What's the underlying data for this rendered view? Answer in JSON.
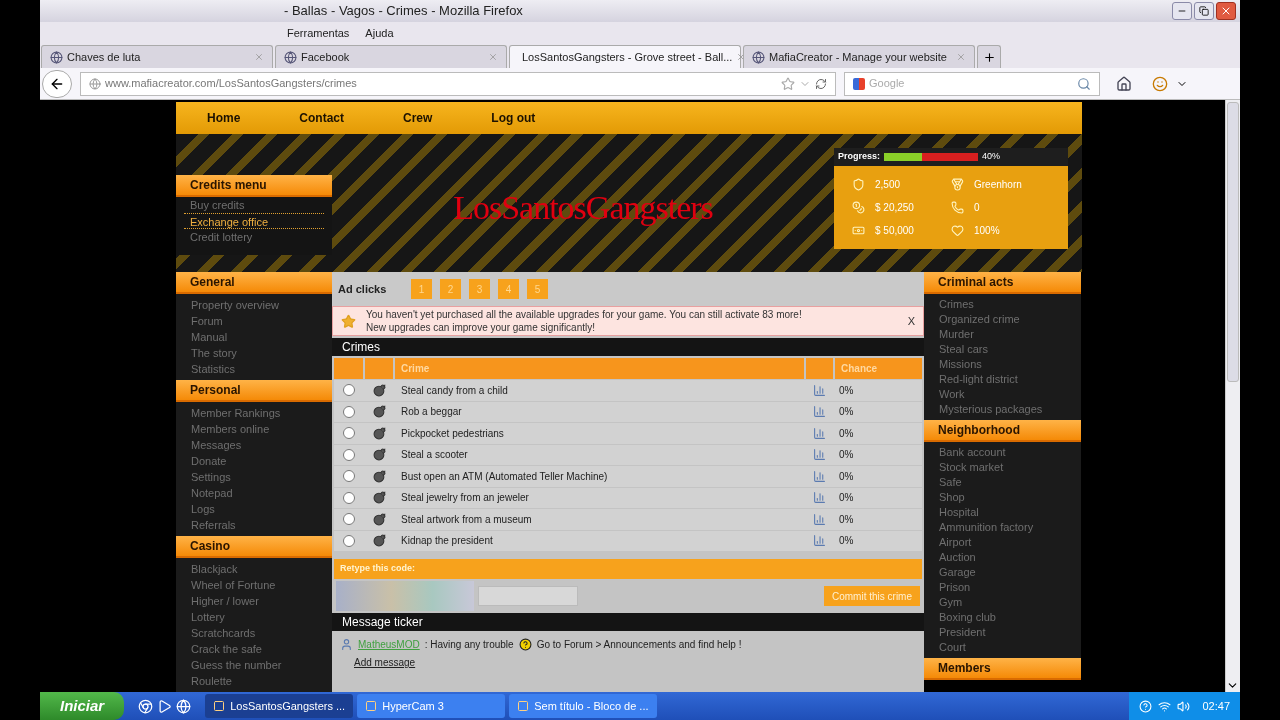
{
  "window": {
    "title": "- Ballas - Vagos - Crimes - Mozilla Firefox"
  },
  "menu": [
    "Ferramentas",
    "Ajuda"
  ],
  "tabs": [
    {
      "label": "Chaves de luta",
      "selected": false
    },
    {
      "label": "Facebook",
      "selected": false
    },
    {
      "label": "LosSantosGangsters - Grove street - Ball...",
      "selected": true
    },
    {
      "label": "MafiaCreator - Manage your website",
      "selected": false
    }
  ],
  "address": {
    "url": "www.mafiacreator.com/LosSantosGangsters/crimes"
  },
  "search": {
    "placeholder": "Google"
  },
  "site_nav": [
    "Home",
    "Contact",
    "Crew",
    "Log out"
  ],
  "banner": {
    "logo": "LosSantosGangsters"
  },
  "progress": {
    "label": "Progress:",
    "level": 0.4,
    "reading": "40%"
  },
  "stats": [
    {
      "kind": "shield",
      "value": "2,500"
    },
    {
      "kind": "medal",
      "value": "Greenhorn"
    },
    {
      "kind": "coins",
      "value": "$ 20,250"
    },
    {
      "kind": "phone",
      "value": "0"
    },
    {
      "kind": "cash",
      "value": "$ 50,000"
    },
    {
      "kind": "heart",
      "value": "100%"
    }
  ],
  "credits_menu": {
    "title": "Credits menu",
    "items": [
      {
        "label": "Buy credits",
        "selected": false
      },
      {
        "label": "Exchange office",
        "selected": true
      },
      {
        "label": "Credit lottery",
        "selected": false
      }
    ]
  },
  "left_sections": [
    {
      "title": "General",
      "items": [
        "Property overview",
        "Forum",
        "Manual",
        "The story",
        "Statistics"
      ]
    },
    {
      "title": "Personal",
      "items": [
        "Member Rankings",
        "Members online",
        "Messages",
        "Donate",
        "Settings",
        "Notepad",
        "Logs",
        "Referrals"
      ]
    },
    {
      "title": "Casino",
      "items": [
        "Blackjack",
        "Wheel of Fortune",
        "Higher / lower",
        "Lottery",
        "Scratchcards",
        "Crack the safe",
        "Guess the number",
        "Roulette"
      ]
    }
  ],
  "ad_clicks": {
    "label": "Ad clicks",
    "buttons": [
      "1",
      "2",
      "3",
      "4",
      "5"
    ]
  },
  "notice": {
    "lines": [
      "You haven't yet purchased all the available upgrades for your game. You can still activate 83 more!",
      "New upgrades can improve your game significantly!"
    ],
    "close": "X"
  },
  "crimes": {
    "title": "Crimes",
    "columns": [
      "Crime",
      "Chance"
    ],
    "rows": [
      {
        "name": "Steal candy from a child",
        "chance": "0%",
        "selected": false
      },
      {
        "name": "Rob a beggar",
        "chance": "0%",
        "selected": false
      },
      {
        "name": "Pickpocket pedestrians",
        "chance": "0%",
        "selected": false
      },
      {
        "name": "Steal a scooter",
        "chance": "0%",
        "selected": false
      },
      {
        "name": "Bust open an ATM (Automated Teller Machine)",
        "chance": "0%",
        "selected": false
      },
      {
        "name": "Steal jewelry from an jeweler",
        "chance": "0%",
        "selected": false
      },
      {
        "name": "Steal artwork from a museum",
        "chance": "0%",
        "selected": false
      },
      {
        "name": "Kidnap the president",
        "chance": "0%",
        "selected": false
      }
    ]
  },
  "captcha": {
    "label": "Retype this code:",
    "button": "Commit this crime"
  },
  "ticker": {
    "title": "Message ticker",
    "user": "MatheusMOD",
    "message": ": Having any trouble",
    "link_text": "Go to Forum > Announcements and find help !",
    "add": "Add message"
  },
  "right_sections": [
    {
      "title": "Criminal acts",
      "items": [
        "Crimes",
        "Organized crime",
        "Murder",
        "Steal cars",
        "Missions",
        "Red-light district",
        "Work",
        "Mysterious packages"
      ]
    },
    {
      "title": "Neighborhood",
      "items": [
        "Bank account",
        "Stock market",
        "Safe",
        "Shop",
        "Hospital",
        "Ammunition factory",
        "Airport",
        "Auction",
        "Garage",
        "Prison",
        "Gym",
        "Boxing club",
        "President",
        "Court"
      ]
    },
    {
      "title": "Members"
    }
  ],
  "taskbar": {
    "start": "Iniciar",
    "tasks": [
      {
        "label": "LosSantosGangsters ...",
        "selected": true
      },
      {
        "label": "HyperCam 3",
        "selected": false
      },
      {
        "label": "Sem título - Bloco de ...",
        "selected": false
      }
    ],
    "clock": "02:47"
  }
}
